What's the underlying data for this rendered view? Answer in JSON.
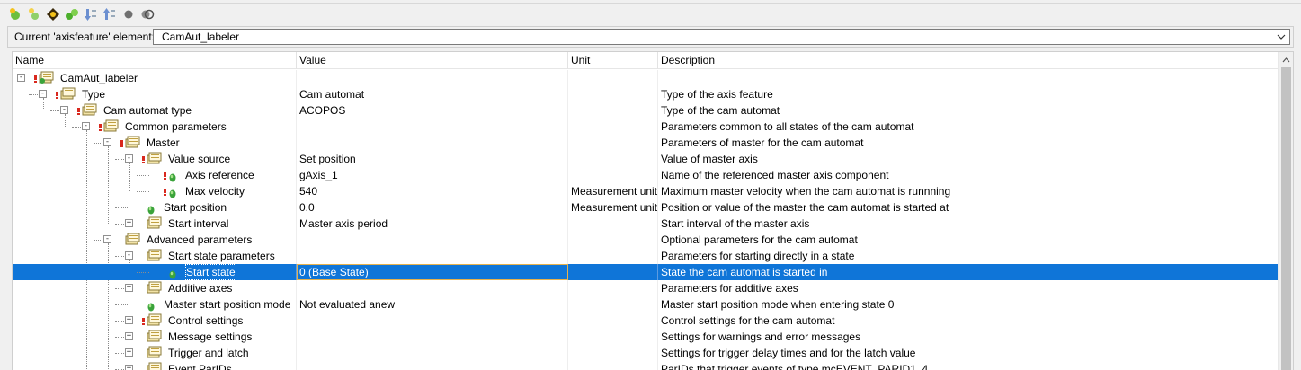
{
  "toolbar": {
    "buttons": [
      {
        "icon": "add-element-icon"
      },
      {
        "icon": "add-child-icon"
      },
      {
        "icon": "navigate-icon"
      },
      {
        "icon": "expand-icon"
      },
      {
        "icon": "sort-descending-icon"
      },
      {
        "icon": "sort-ascending-icon"
      },
      {
        "icon": "circle-icon"
      },
      {
        "icon": "settings-icon"
      }
    ]
  },
  "selector": {
    "label": "Current 'axisfeature' element:",
    "value": "CamAut_labeler"
  },
  "columns": {
    "name": "Name",
    "value": "Value",
    "unit": "Unit",
    "description": "Description"
  },
  "rows": [
    {
      "name": "CamAut_labeler",
      "value": "",
      "unit": "",
      "description": ""
    },
    {
      "name": "Type",
      "value": "Cam automat",
      "unit": "",
      "description": "Type of the axis feature"
    },
    {
      "name": "Cam automat type",
      "value": "ACOPOS",
      "unit": "",
      "description": "Type of the cam automat"
    },
    {
      "name": "Common parameters",
      "value": "",
      "unit": "",
      "description": "Parameters common to all states of the cam automat"
    },
    {
      "name": "Master",
      "value": "",
      "unit": "",
      "description": "Parameters of master for the cam automat"
    },
    {
      "name": "Value source",
      "value": "Set position",
      "unit": "",
      "description": "Value of master axis"
    },
    {
      "name": "Axis reference",
      "value": "gAxis_1",
      "unit": "",
      "description": "Name of the referenced master axis component"
    },
    {
      "name": "Max velocity",
      "value": "540",
      "unit": "Measurement unit...",
      "description": "Maximum master velocity when the cam automat is runnning"
    },
    {
      "name": "Start position",
      "value": "0.0",
      "unit": "Measurement unit...",
      "description": "Position or value of the master the cam automat is started at"
    },
    {
      "name": "Start interval",
      "value": "Master axis period",
      "unit": "",
      "description": "Start interval of the master axis"
    },
    {
      "name": "Advanced parameters",
      "value": "",
      "unit": "",
      "description": "Optional parameters for the cam automat"
    },
    {
      "name": "Start state parameters",
      "value": "",
      "unit": "",
      "description": "Parameters for starting directly in a state"
    },
    {
      "name": "Start state",
      "value": "0 (Base State)",
      "unit": "",
      "description": "State the cam automat is started in"
    },
    {
      "name": "Additive axes",
      "value": "",
      "unit": "",
      "description": "Parameters for additive axes"
    },
    {
      "name": "Master start position mode",
      "value": "Not evaluated anew",
      "unit": "",
      "description": "Master start position mode when entering state 0"
    },
    {
      "name": "Control settings",
      "value": "",
      "unit": "",
      "description": "Control settings for the cam automat"
    },
    {
      "name": "Message settings",
      "value": "",
      "unit": "",
      "description": "Settings for warnings and error messages"
    },
    {
      "name": "Trigger and latch",
      "value": "",
      "unit": "",
      "description": "Settings for trigger delay times and for the latch value"
    },
    {
      "name": "Event ParIDs",
      "value": "",
      "unit": "",
      "description": "ParIDs that trigger events of type mcEVENT_PARID1..4"
    }
  ],
  "selected_row": "Start state",
  "colors": {
    "selection": "#0f75d8",
    "warning": "#d9281e",
    "param_green": "#3aa33a"
  }
}
